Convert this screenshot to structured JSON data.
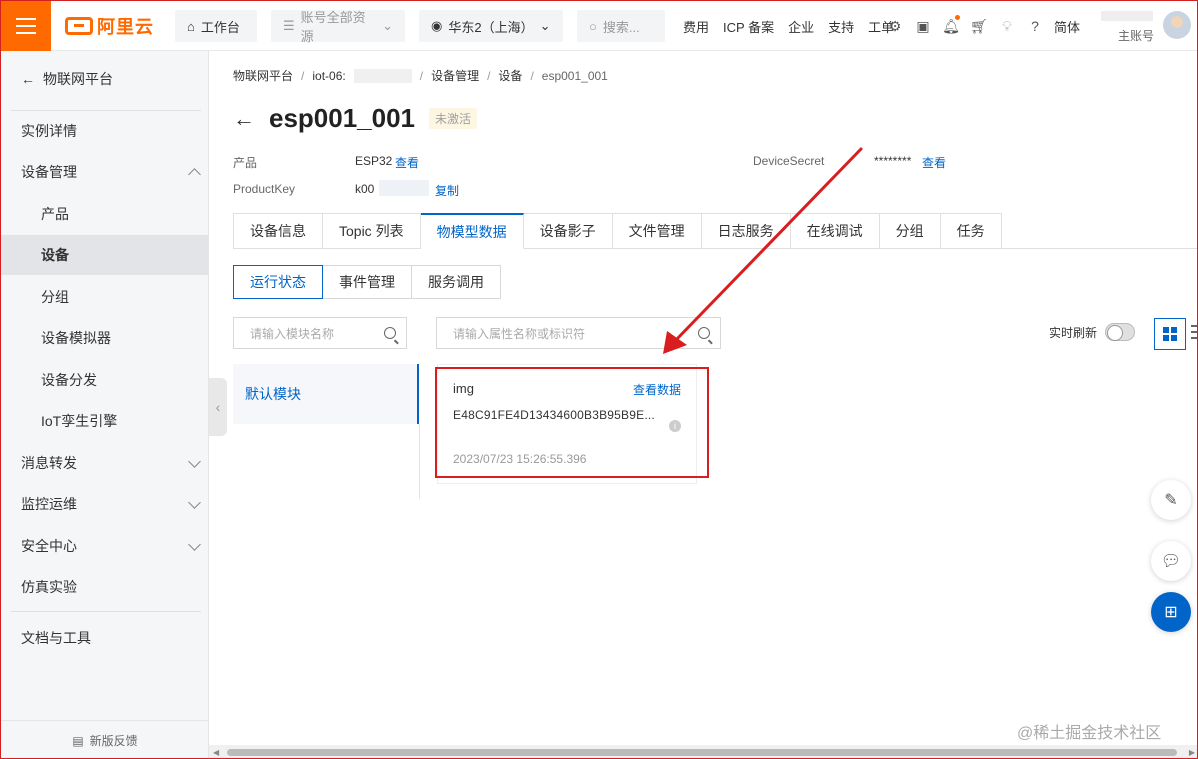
{
  "header": {
    "brand": "阿里云",
    "workbench": "工作台",
    "resources": "账号全部资源",
    "region": "华东2（上海）",
    "search_placeholder": "搜索...",
    "links": [
      "费用",
      "ICP 备案",
      "企业",
      "支持",
      "工单"
    ],
    "language": "简体",
    "account_role": "主账号"
  },
  "sidebar": {
    "back_label": "物联网平台",
    "items": [
      {
        "label": "实例详情",
        "level": 1
      },
      {
        "label": "设备管理",
        "level": 1,
        "expanded": true
      },
      {
        "label": "产品",
        "level": 2
      },
      {
        "label": "设备",
        "level": 2,
        "active": true
      },
      {
        "label": "分组",
        "level": 2
      },
      {
        "label": "设备模拟器",
        "level": 2
      },
      {
        "label": "设备分发",
        "level": 2
      },
      {
        "label": "IoT孪生引擎",
        "level": 2
      },
      {
        "label": "消息转发",
        "level": 1,
        "collapsible": true
      },
      {
        "label": "监控运维",
        "level": 1,
        "collapsible": true
      },
      {
        "label": "安全中心",
        "level": 1,
        "collapsible": true
      },
      {
        "label": "仿真实验",
        "level": 1
      },
      {
        "label": "文档与工具",
        "level": 1
      }
    ],
    "feedback": "新版反馈"
  },
  "breadcrumb": [
    "物联网平台",
    "iot-06:",
    "设备管理",
    "设备",
    "esp001_001"
  ],
  "device": {
    "name": "esp001_001",
    "status": "未激活",
    "product_label": "产品",
    "product_value": "ESP32",
    "product_link": "查看",
    "productkey_label": "ProductKey",
    "productkey_value": "k00",
    "productkey_link": "复制",
    "secret_label": "DeviceSecret",
    "secret_value": "********",
    "secret_link": "查看"
  },
  "tabs": [
    "设备信息",
    "Topic 列表",
    "物模型数据",
    "设备影子",
    "文件管理",
    "日志服务",
    "在线调试",
    "分组",
    "任务"
  ],
  "active_tab": "物模型数据",
  "subtabs": [
    "运行状态",
    "事件管理",
    "服务调用"
  ],
  "active_subtab": "运行状态",
  "module_search_placeholder": "请输入模块名称",
  "property_search_placeholder": "请输入属性名称或标识符",
  "module_default": "默认模块",
  "realtime_label": "实时刷新",
  "realtime_on": false,
  "property_card": {
    "name": "img",
    "view_link": "查看数据",
    "value": "E48C91FE4D13434600B3B95B9E...",
    "timestamp": "2023/07/23 15:26:55.396"
  },
  "watermark": "@稀土掘金技术社区",
  "colors": {
    "brand": "#ff6a00",
    "link": "#0064c8",
    "highlight": "#d81e1e"
  }
}
